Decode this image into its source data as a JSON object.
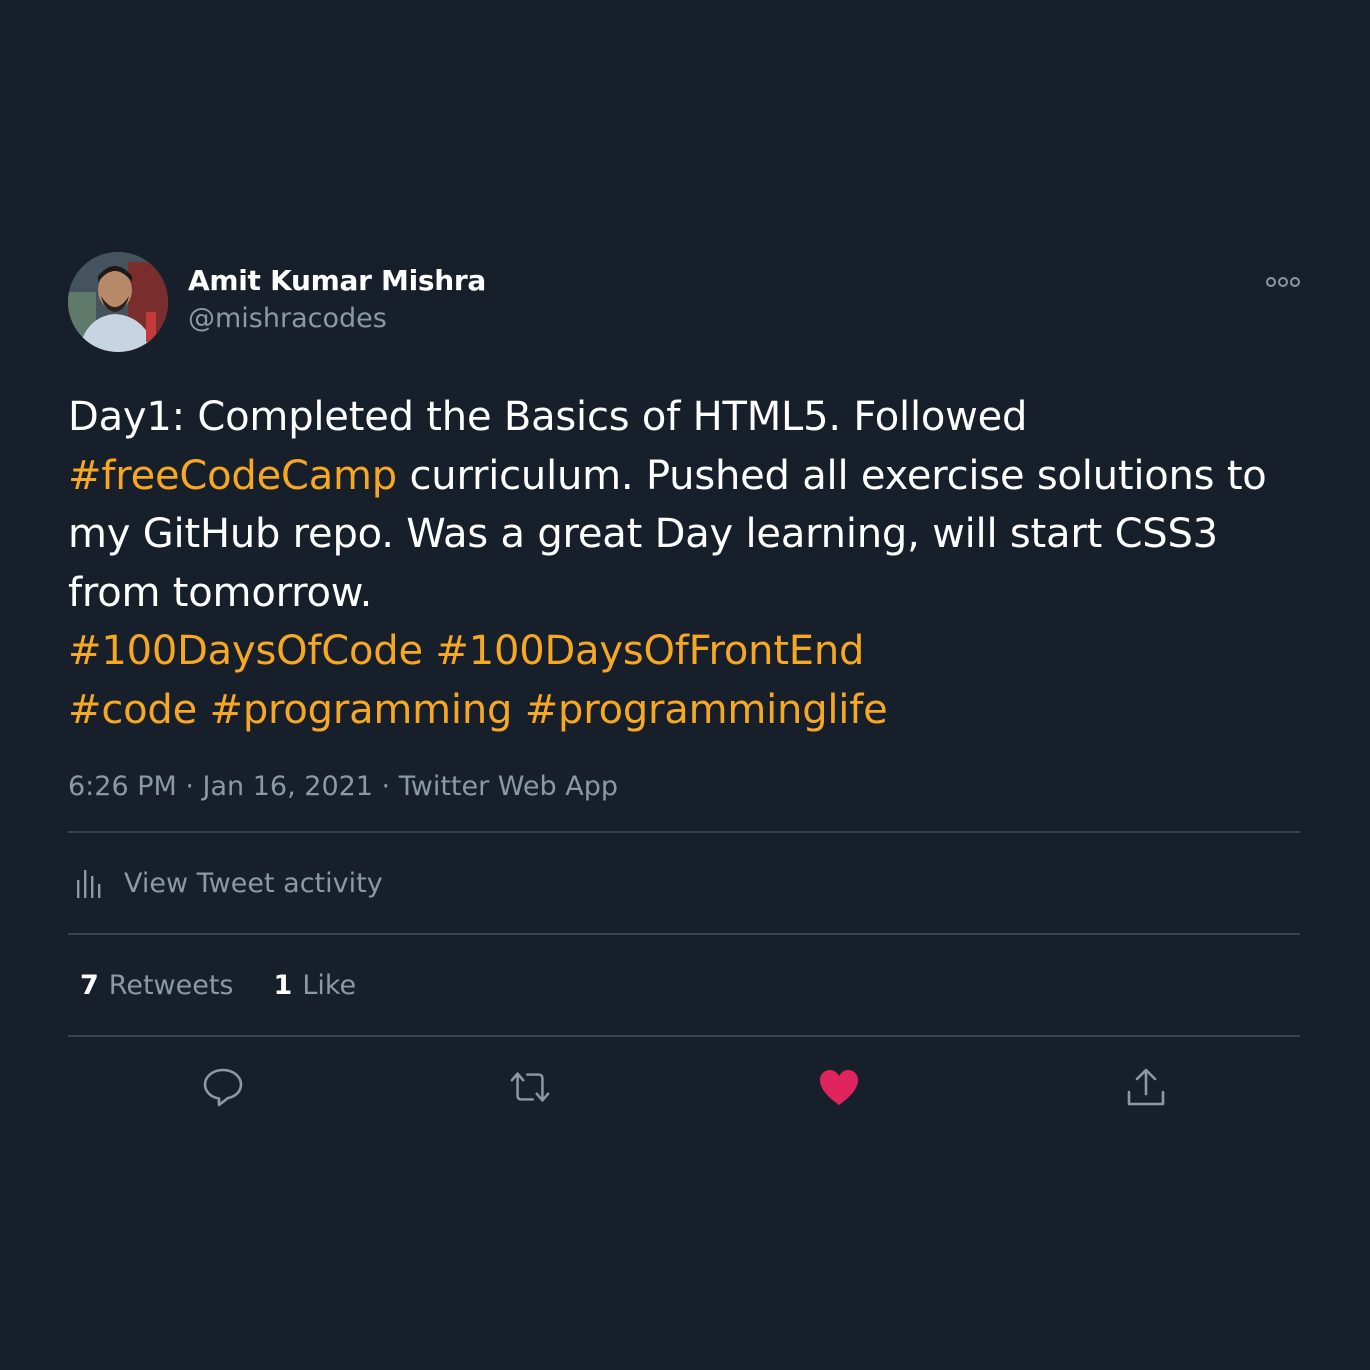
{
  "author": {
    "name": "Amit Kumar Mishra",
    "handle": "@mishracodes"
  },
  "tweet": {
    "segments": [
      {
        "text": "Day1: Completed the Basics of HTML5. Followed ",
        "hashtag": false
      },
      {
        "text": "#freeCodeCamp",
        "hashtag": true
      },
      {
        "text": " curriculum. Pushed all exercise solutions to my GitHub repo. Was a great Day learning, will start CSS3 from tomorrow.",
        "hashtag": false
      },
      {
        "text": "#100DaysOfCode",
        "hashtag": true
      },
      {
        "text": " ",
        "hashtag": false
      },
      {
        "text": "#100DaysOfFrontEnd",
        "hashtag": true
      },
      {
        "text": "#code",
        "hashtag": true
      },
      {
        "text": " ",
        "hashtag": false
      },
      {
        "text": "#programming",
        "hashtag": true
      },
      {
        "text": " ",
        "hashtag": false
      },
      {
        "text": "#programminglife",
        "hashtag": true
      }
    ],
    "timestamp": "6:26 PM · Jan 16, 2021 · Twitter Web App"
  },
  "activity_label": "View Tweet activity",
  "stats": {
    "retweets_count": "7",
    "retweets_label": "Retweets",
    "likes_count": "1",
    "likes_label": "Like"
  },
  "icons": {
    "more": "more-icon",
    "activity": "bar-chart-icon",
    "reply": "reply-icon",
    "retweet": "retweet-icon",
    "like": "heart-icon",
    "share": "share-icon"
  },
  "colors": {
    "background": "#171f2a",
    "hashtag": "#f7a823",
    "secondary_text": "#8b98a5",
    "like_active": "#e0245e",
    "divider": "#38444d"
  }
}
